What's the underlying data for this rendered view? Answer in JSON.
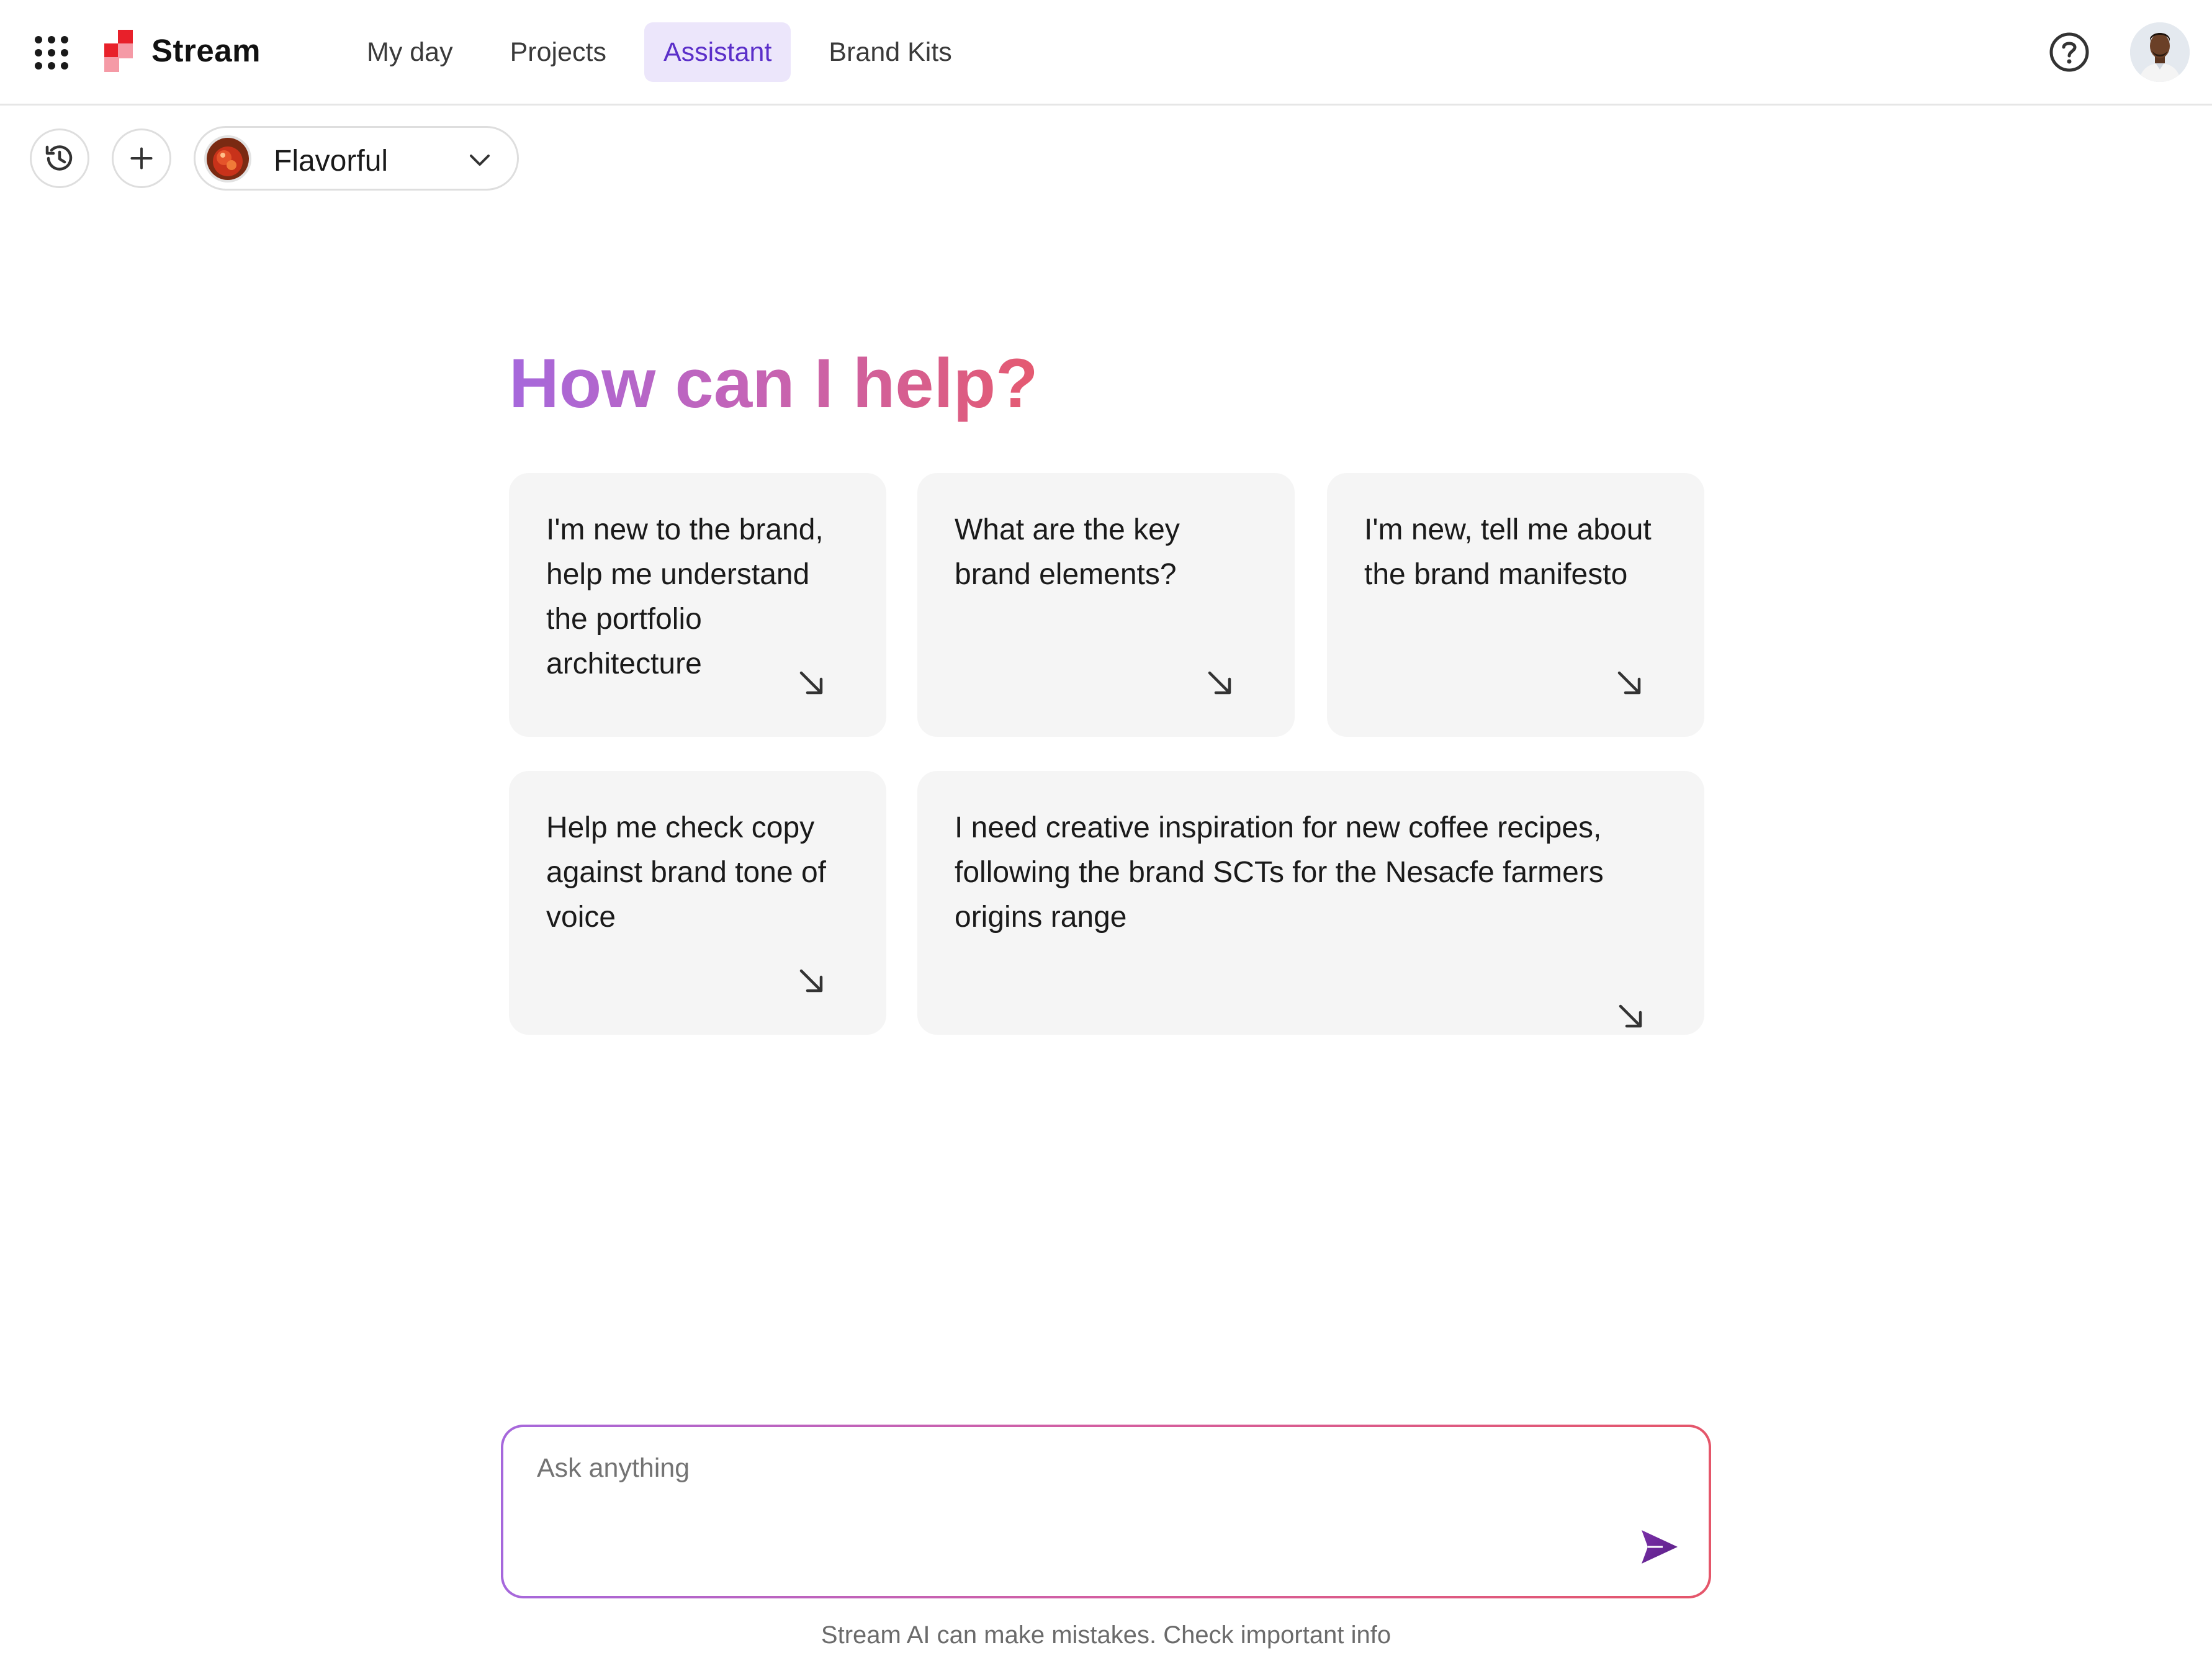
{
  "header": {
    "app_name": "Stream",
    "nav": [
      {
        "label": "My day",
        "active": false
      },
      {
        "label": "Projects",
        "active": false
      },
      {
        "label": "Assistant",
        "active": true
      },
      {
        "label": "Brand Kits",
        "active": false
      }
    ],
    "icons": {
      "apps": "apps-grid-icon",
      "help": "help-circle-icon",
      "avatar": "user-avatar"
    }
  },
  "toolbar": {
    "history_icon": "history-icon",
    "new_icon": "plus-icon",
    "brand_kit": {
      "label": "Flavorful",
      "chevron": "chevron-down-icon"
    }
  },
  "main": {
    "heading": "How can I help?",
    "suggestions": [
      {
        "text": "I'm new to the brand, help me understand the portfolio architecture"
      },
      {
        "text": "What are the key brand elements?"
      },
      {
        "text": "I'm new, tell me about the brand manifesto"
      },
      {
        "text": "Help me check copy against brand tone of voice"
      },
      {
        "text": "I need creative inspiration for new coffee recipes, following the brand SCTs for the Nesacfe farmers origins range"
      }
    ]
  },
  "composer": {
    "placeholder": "Ask anything",
    "value": "",
    "send_icon": "send-icon"
  },
  "footer": {
    "disclaimer": "Stream AI can make mistakes. Check important info"
  },
  "colors": {
    "accent": "#5b2fc9",
    "active_nav_bg": "#ece6fb",
    "gradient_start": "#a668dc",
    "gradient_end": "#e55a70",
    "card_bg": "#f5f5f5",
    "logo_red": "#e8202a",
    "logo_pink": "#f59aa6",
    "send_purple": "#6e2a93"
  }
}
